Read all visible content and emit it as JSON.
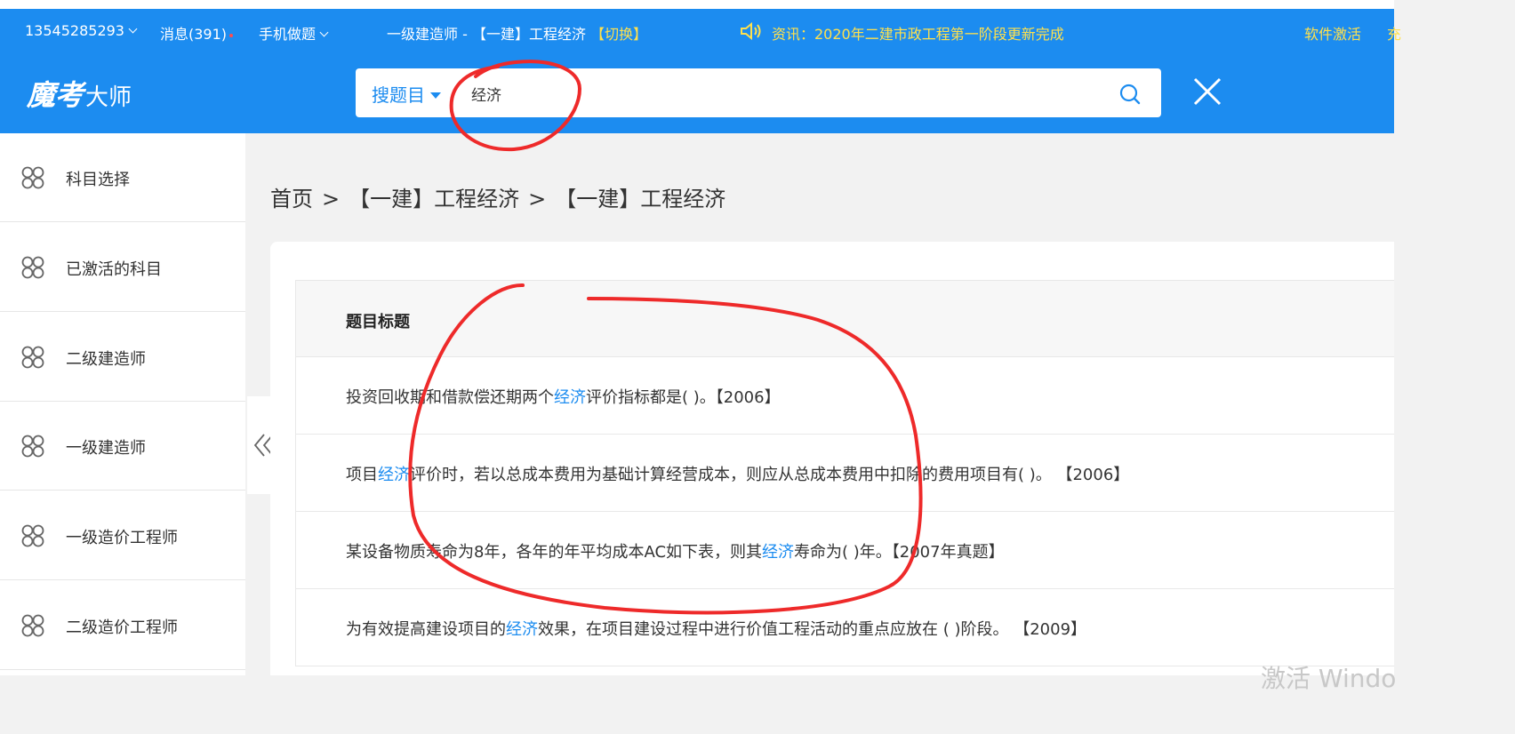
{
  "topbar": {
    "phone": "13545285293",
    "messages": "消息(391)",
    "mobile": "手机做题",
    "course_title": "一级建造师 - 【一建】工程经济",
    "switch_label": "【切换】",
    "news": "资讯：2020年二建市政工程第一阶段更新完成",
    "activate": "软件激活",
    "edge_char": "充"
  },
  "header": {
    "logo_script": "魔考",
    "logo_text": "大师",
    "search_type": "搜题目",
    "search_value": "经济"
  },
  "sidebar": {
    "items": [
      {
        "label": "科目选择"
      },
      {
        "label": "已激活的科目"
      },
      {
        "label": "二级建造师"
      },
      {
        "label": "一级建造师"
      },
      {
        "label": "一级造价工程师"
      },
      {
        "label": "二级造价工程师"
      }
    ]
  },
  "breadcrumb": {
    "home": "首页",
    "sep": ">",
    "level1": "【一建】工程经济",
    "level2": "【一建】工程经济"
  },
  "table": {
    "header": "题目标题",
    "rows": [
      {
        "pre": "投资回收期和借款偿还期两个",
        "hl": "经济",
        "post": "评价指标都是( )。【2006】"
      },
      {
        "pre": "项目",
        "hl": "经济",
        "post": "评价时，若以总成本费用为基础计算经营成本，则应从总成本费用中扣除的费用项目有( )。 【2006】"
      },
      {
        "pre": "某设备物质寿命为8年，各年的年平均成本AC如下表，则其",
        "hl": "经济",
        "post": "寿命为( )年。【2007年真题】"
      },
      {
        "pre": "为有效提高建设项目的",
        "hl": "经济",
        "post": "效果，在项目建设过程中进行价值工程活动的重点应放在 ( )阶段。 【2009】"
      }
    ]
  },
  "watermark": "激活 Windo",
  "colors": {
    "brand": "#1c8cf0",
    "news": "#ffe14d",
    "annotation": "#ee2a2a"
  }
}
